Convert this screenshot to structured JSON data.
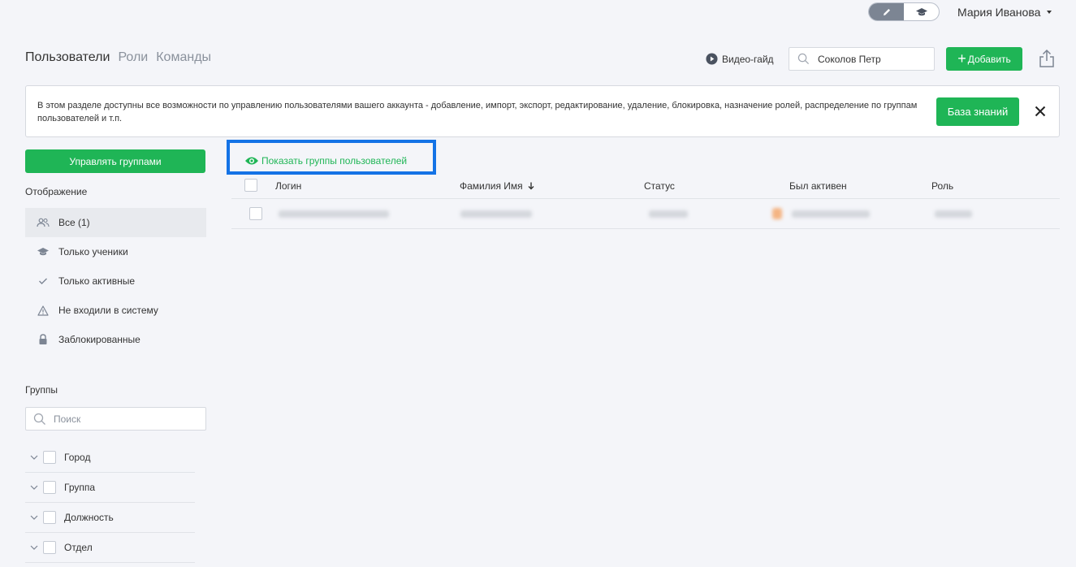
{
  "topbar": {
    "user_name": "Мария Иванова",
    "mode_edit_icon": "pencil-icon",
    "mode_learn_icon": "graduation-cap-icon"
  },
  "tabs": [
    {
      "label": "Пользователи",
      "active": true
    },
    {
      "label": "Роли",
      "active": false
    },
    {
      "label": "Команды",
      "active": false
    }
  ],
  "header": {
    "video_guide": "Видео-гайд",
    "search_value": "Соколов Петр",
    "add_label": "Добавить"
  },
  "banner": {
    "text": "В этом разделе доступны все возможности по управлению пользователями вашего аккаунта - добавление, импорт, экспорт, редактирование, удаление, блокировка, назначение ролей, распределение по группам пользователей и т.п.",
    "kb_label": "База знаний"
  },
  "sidebar": {
    "manage_groups_label": "Управлять группами",
    "display_title": "Отображение",
    "filters": [
      {
        "label": "Все (1)",
        "icon": "users-icon",
        "active": true
      },
      {
        "label": "Только ученики",
        "icon": "graduation-cap-icon",
        "active": false
      },
      {
        "label": "Только активные",
        "icon": "check-icon",
        "active": false
      },
      {
        "label": "Не входили в систему",
        "icon": "warning-icon",
        "active": false
      },
      {
        "label": "Заблокированные",
        "icon": "lock-icon",
        "active": false
      }
    ],
    "groups_title": "Группы",
    "groups_search_placeholder": "Поиск",
    "groups": [
      {
        "label": "Город"
      },
      {
        "label": "Группа"
      },
      {
        "label": "Должность"
      },
      {
        "label": "Отдел"
      }
    ]
  },
  "table": {
    "show_groups_label": "Показать группы пользователей",
    "columns": {
      "login": "Логин",
      "name": "Фамилия Имя",
      "status": "Статус",
      "last_active": "Был активен",
      "role": "Роль"
    }
  },
  "colors": {
    "accent": "#1fb556",
    "highlight": "#1473e6",
    "background": "#f4f5f9"
  }
}
